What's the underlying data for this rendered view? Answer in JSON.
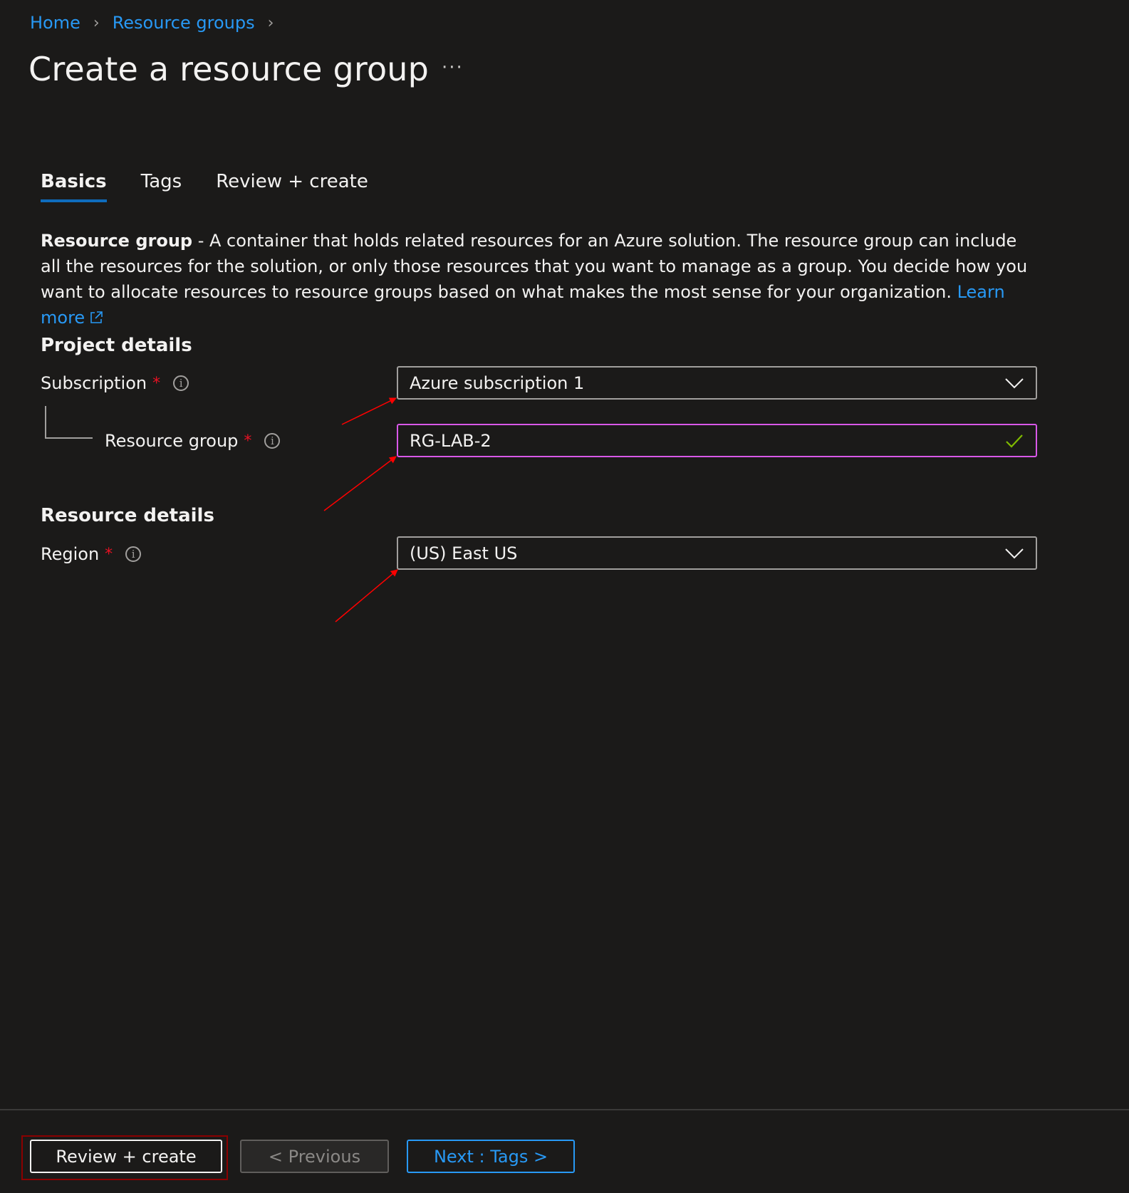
{
  "breadcrumb": {
    "items": [
      "Home",
      "Resource groups"
    ]
  },
  "page": {
    "title": "Create a resource group",
    "more_label": "···"
  },
  "tabs": [
    {
      "label": "Basics",
      "active": true
    },
    {
      "label": "Tags",
      "active": false
    },
    {
      "label": "Review + create",
      "active": false
    }
  ],
  "description": {
    "term": "Resource group",
    "text": " - A container that holds related resources for an Azure solution. The resource group can include all the resources for the solution, or only those resources that you want to manage as a group. You decide how you want to allocate resources to resource groups based on what makes the most sense for your organization. ",
    "learn_more": "Learn more"
  },
  "project_details": {
    "heading": "Project details",
    "subscription": {
      "label": "Subscription",
      "required": "*",
      "value": "Azure subscription 1",
      "icon": "chevron-down-icon"
    },
    "resource_group": {
      "label": "Resource group",
      "required": "*",
      "value": "RG-LAB-2",
      "validation_icon": "checkmark-icon",
      "validation_color": "#7fba00"
    }
  },
  "resource_details": {
    "heading": "Resource details",
    "region": {
      "label": "Region",
      "required": "*",
      "value": "(US) East US",
      "icon": "chevron-down-icon"
    }
  },
  "footer": {
    "review_create": "Review + create",
    "previous": "< Previous",
    "next": "Next : Tags >"
  },
  "colors": {
    "accent": "#2899f5",
    "focus_border": "#d858e8",
    "required": "#e81123",
    "annotation": "#ff0000"
  }
}
